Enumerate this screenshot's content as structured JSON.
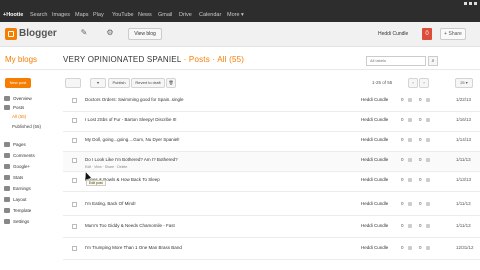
{
  "google_bar": {
    "tabs": [
      "+Hootie",
      "Search",
      "Images",
      "Maps",
      "Play",
      "YouTube",
      "News",
      "Gmail",
      "Drive",
      "Calendar",
      "More ▾"
    ]
  },
  "header": {
    "logo_text": "Blogger",
    "view_blog": "View blog",
    "user": "Heddi Cundle",
    "notifications": "0",
    "share": "+ Share"
  },
  "sidebar": {
    "my_blogs": "My blogs",
    "new_post": "New post",
    "items": [
      {
        "label": "Overview",
        "level": 0,
        "active": false
      },
      {
        "label": "Posts",
        "level": 0,
        "active": false
      },
      {
        "label": "All (55)",
        "level": 1,
        "active": true
      },
      {
        "label": "Published (55)",
        "level": 1,
        "active": false
      },
      {
        "label": "Pages",
        "level": 0,
        "active": false
      },
      {
        "label": "Comments",
        "level": 0,
        "active": false
      },
      {
        "label": "Google+",
        "level": 0,
        "active": false
      },
      {
        "label": "Stats",
        "level": 0,
        "active": false
      },
      {
        "label": "Earnings",
        "level": 0,
        "active": false
      },
      {
        "label": "Layout",
        "level": 0,
        "active": false
      },
      {
        "label": "Template",
        "level": 0,
        "active": false
      },
      {
        "label": "Settings",
        "level": 0,
        "active": false
      }
    ]
  },
  "main": {
    "blog_title": "VERY OPINIONATED SPANIEL",
    "crumb_sep": "·",
    "crumb_posts": "Posts",
    "crumb_all": "All (55)",
    "search_placeholder": "All labels",
    "toolbar": {
      "publish": "Publish",
      "revert": "Revert to draft",
      "delete": "Delete"
    },
    "range": "1-25 of 55",
    "posts": [
      {
        "title": "Doctors Orders: Swimming good for Spain..single",
        "author": "Heddi Cundle",
        "c1": "0",
        "c2": "0",
        "date": "1/22/13"
      },
      {
        "title": "I Lost 2Sbs of Fur - Barton Sleepy! Discribe It!",
        "author": "Heddi Cundle",
        "c1": "0",
        "c2": "0",
        "date": "1/16/13"
      },
      {
        "title": "My Doll, going...going....Gum, Nu Dyer Spaniel!",
        "author": "Heddi Cundle",
        "c1": "0",
        "c2": "0",
        "date": "1/14/13"
      },
      {
        "title": "Do I Look Like I'm Bothered? Am I? Bothered?",
        "author": "Heddi Cundle",
        "c1": "0",
        "c2": "0",
        "date": "1/11/13"
      },
      {
        "title": "Bones & Bowls & How Back To Sleep",
        "author": "Heddi Cundle",
        "c1": "0",
        "c2": "0",
        "date": "1/13/13"
      },
      {
        "title": "I'm Eating, Back Of Mind!",
        "author": "Heddi Cundle",
        "c1": "0",
        "c2": "0",
        "date": "1/11/13"
      },
      {
        "title": "Mum's Too Giddy & Needs Chamomile - Fast",
        "author": "Heddi Cundle",
        "c1": "0",
        "c2": "0",
        "date": "1/11/13"
      },
      {
        "title": "I'm Trumping More Than 1 One Man Brass Band",
        "author": "Heddi Cundle",
        "c1": "0",
        "c2": "0",
        "date": "12/31/12"
      }
    ],
    "hover_actions": "Edit · View · Share · Delete",
    "tooltip": "Edit post"
  }
}
